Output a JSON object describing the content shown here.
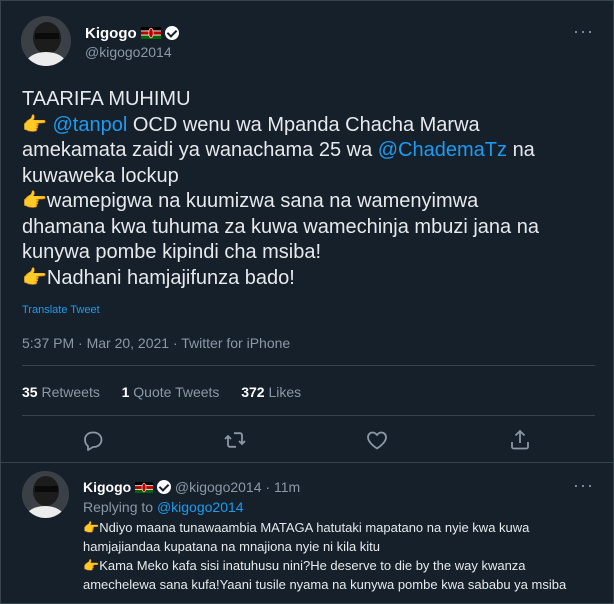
{
  "main_tweet": {
    "display_name": "Kigogo",
    "handle": "@kigogo2014",
    "heading": "TAARIFA MUHIMU",
    "line1_mention": "@tanpol",
    "line1_text": "OCD wenu wa Mpanda Chacha Marwa",
    "line2_text": "amekamata zaidi ya wanachama 25 wa",
    "line2_mention": "@ChademaTz",
    "line2_tail": "na",
    "line3_text": "kuwaweka lockup",
    "line4_text": "wamepigwa na kuumizwa sana na wamenyimwa",
    "line5_text": "dhamana kwa tuhuma za kuwa wamechinja mbuzi jana na",
    "line6_text": "kunywa pombe kipindi cha msiba!",
    "line7_text": "Nadhani hamjajifunza bado!",
    "translate": "Translate Tweet",
    "timestamp": "5:37 PM · Mar 20, 2021 · Twitter for iPhone",
    "retweets_count": "35",
    "retweets_label": "Retweets",
    "quotes_count": "1",
    "quotes_label": "Quote Tweets",
    "likes_count": "372",
    "likes_label": "Likes"
  },
  "reply": {
    "display_name": "Kigogo",
    "handle": "@kigogo2014",
    "time": "· 11m",
    "replying_to_label": "Replying to",
    "replying_to_handle": "@kigogo2014",
    "line1": "Ndiyo maana tunawaambia MATAGA hatutaki mapatano na nyie kwa kuwa",
    "line2": "hamjajiandaa kupatana na mnajiona nyie ni kila kitu",
    "line3": "Kama Meko kafa sisi inatuhusu nini?He deserve to die by the way kwanza",
    "line4": "amechelewa sana kufa!Yaani tusile nyama na kunywa pombe kwa sababu ya msiba"
  },
  "icons": {
    "pointing": "backhand-index-pointing-right-emoji",
    "verified": "verified-badge-icon",
    "flag": "kenya-flag-emoji",
    "more": "more-icon",
    "reply": "reply-icon",
    "retweet": "retweet-icon",
    "like": "like-icon",
    "share": "share-icon"
  },
  "colors": {
    "background": "#15202b",
    "accent": "#1d9bf0",
    "muted": "#8b98a5",
    "divider": "#38444d"
  }
}
